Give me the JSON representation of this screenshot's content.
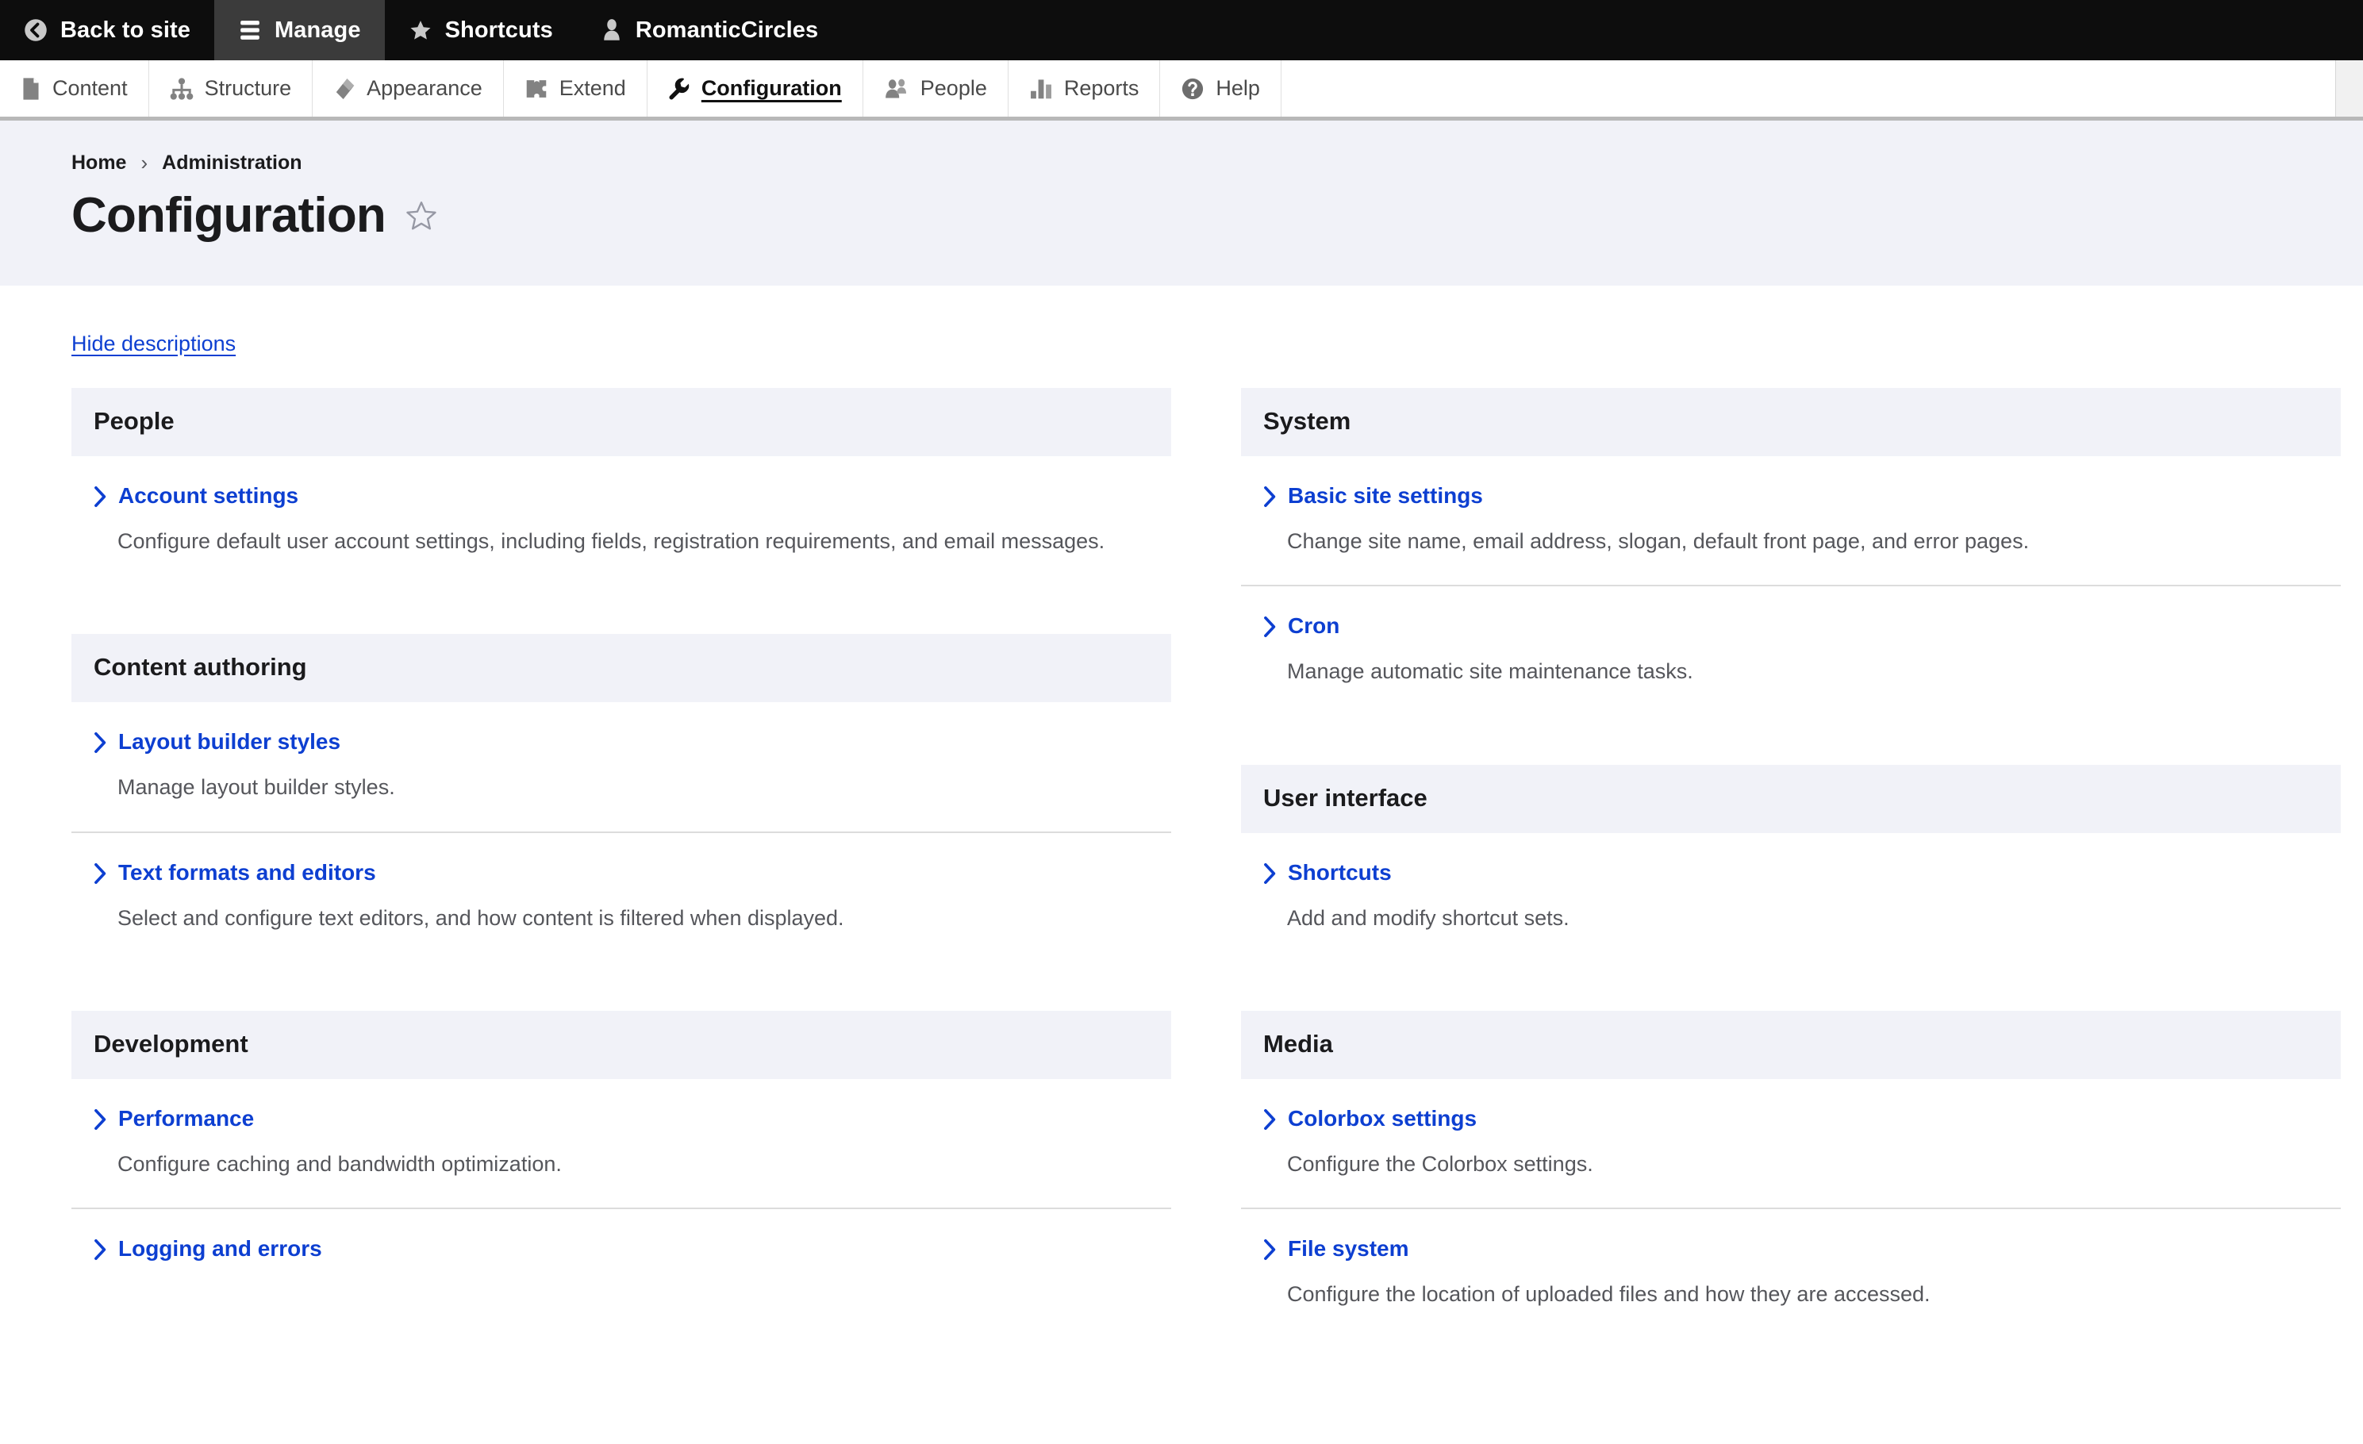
{
  "toolbar": {
    "items": [
      {
        "label": "Back to site",
        "icon": "back-arrow-circle-icon",
        "active": false
      },
      {
        "label": "Manage",
        "icon": "hamburger-menu-icon",
        "active": true
      },
      {
        "label": "Shortcuts",
        "icon": "star-icon",
        "active": false
      },
      {
        "label": "RomanticCircles",
        "icon": "user-account-icon",
        "active": false
      }
    ]
  },
  "admin_nav": {
    "items": [
      {
        "label": "Content",
        "icon": "document-icon",
        "active": false
      },
      {
        "label": "Structure",
        "icon": "sitemap-icon",
        "active": false
      },
      {
        "label": "Appearance",
        "icon": "paintbrush-icon",
        "active": false
      },
      {
        "label": "Extend",
        "icon": "puzzle-piece-icon",
        "active": false
      },
      {
        "label": "Configuration",
        "icon": "wrench-icon",
        "active": true
      },
      {
        "label": "People",
        "icon": "people-icon",
        "active": false
      },
      {
        "label": "Reports",
        "icon": "bar-chart-icon",
        "active": false
      },
      {
        "label": "Help",
        "icon": "question-mark-circle-icon",
        "active": false
      }
    ]
  },
  "page_header": {
    "breadcrumb": [
      "Home",
      "Administration"
    ],
    "breadcrumb_separator": "›",
    "title": "Configuration",
    "favorite_icon": "star-outline-icon"
  },
  "main": {
    "hide_descriptions_label": "Hide descriptions",
    "left_column": [
      {
        "title": "People",
        "entries": [
          {
            "link": "Account settings",
            "description": "Configure default user account settings, including fields, registration requirements, and email messages."
          }
        ]
      },
      {
        "title": "Content authoring",
        "entries": [
          {
            "link": "Layout builder styles",
            "description": "Manage layout builder styles."
          },
          {
            "link": "Text formats and editors",
            "description": "Select and configure text editors, and how content is filtered when displayed."
          }
        ]
      },
      {
        "title": "Development",
        "entries": [
          {
            "link": "Performance",
            "description": "Configure caching and bandwidth optimization."
          },
          {
            "link": "Logging and errors",
            "description": ""
          }
        ]
      }
    ],
    "right_column": [
      {
        "title": "System",
        "entries": [
          {
            "link": "Basic site settings",
            "description": "Change site name, email address, slogan, default front page, and error pages."
          },
          {
            "link": "Cron",
            "description": "Manage automatic site maintenance tasks."
          }
        ]
      },
      {
        "title": "User interface",
        "entries": [
          {
            "link": "Shortcuts",
            "description": "Add and modify shortcut sets."
          }
        ]
      },
      {
        "title": "Media",
        "entries": [
          {
            "link": "Colorbox settings",
            "description": "Configure the Colorbox settings."
          },
          {
            "link": "File system",
            "description": "Configure the location of uploaded files and how they are accessed."
          }
        ]
      }
    ]
  },
  "colors": {
    "toolbar_bg": "#0d0d0d",
    "toolbar_active_bg": "#3b3b3b",
    "link_blue": "#0d3fd1",
    "band_bg": "#f1f2f8",
    "text_dark": "#1b1b1d",
    "text_muted": "#55565b"
  }
}
